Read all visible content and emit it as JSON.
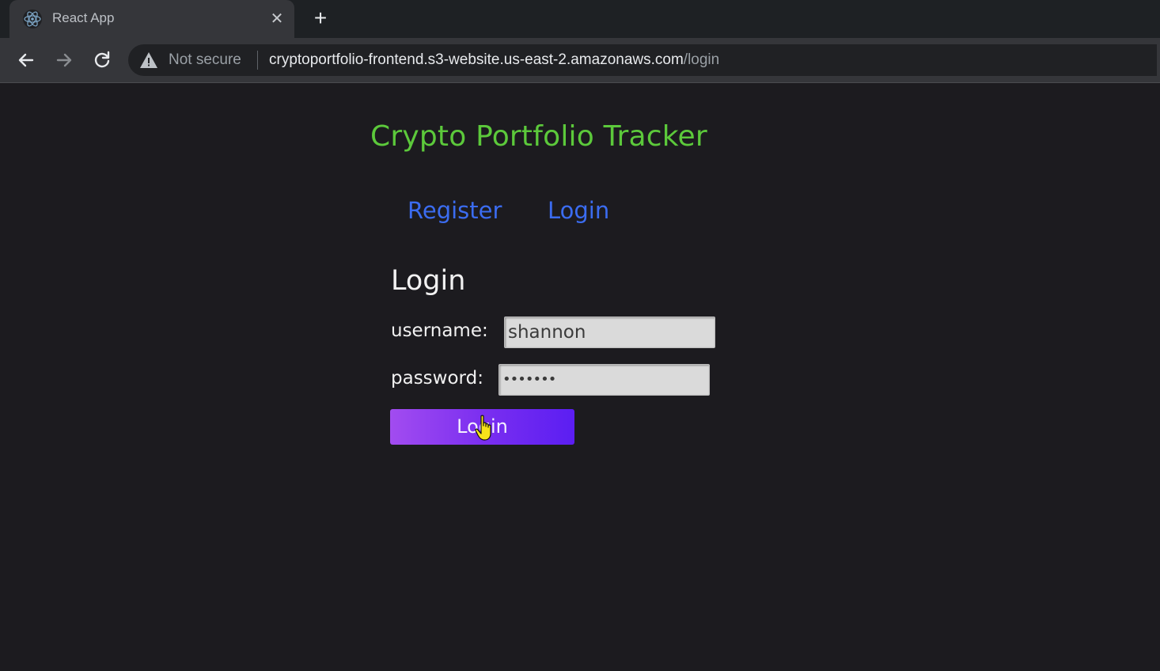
{
  "browser": {
    "tab": {
      "title": "React App",
      "favicon": "react-logo-icon",
      "close_icon": "close-icon"
    },
    "new_tab_icon": "plus-icon",
    "toolbar": {
      "back_icon": "back-arrow-icon",
      "forward_icon": "forward-arrow-icon",
      "reload_icon": "reload-icon",
      "security_icon": "warning-icon",
      "security_label": "Not secure",
      "url_host": "cryptoportfolio-frontend.s3-website.us-east-2.amazonaws.com",
      "url_path": "/login"
    }
  },
  "page": {
    "app_title": "Crypto Portfolio Tracker",
    "nav": {
      "register": "Register",
      "login": "Login"
    },
    "form": {
      "heading": "Login",
      "username_label": "username:",
      "username_value": "shannon",
      "password_label": "password:",
      "password_value": "•••••••",
      "submit_label": "Login"
    }
  },
  "colors": {
    "background": "#1c1b1f",
    "title_green": "#5cc93b",
    "link_blue": "#3b6cf0",
    "button_gradient_start": "#a24cf0",
    "button_gradient_end": "#5b1ef2"
  }
}
